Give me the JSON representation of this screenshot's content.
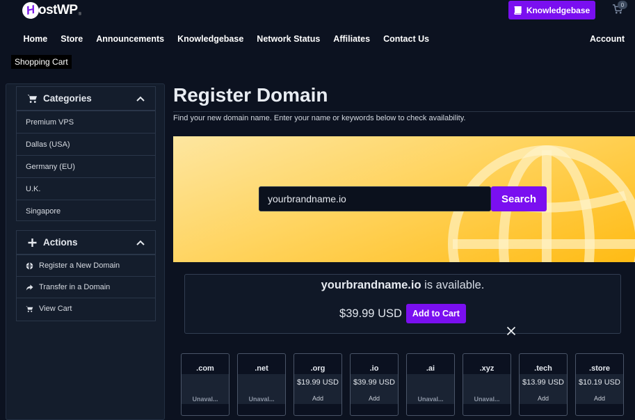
{
  "brand": {
    "logo_letter": "H",
    "logo_text": "ostWP",
    "logo_mark": "®"
  },
  "header": {
    "knowledgebase_button": "Knowledgebase",
    "cart_count": "0"
  },
  "nav": {
    "items": [
      "Home",
      "Store",
      "Announcements",
      "Knowledgebase",
      "Network Status",
      "Affiliates",
      "Contact Us"
    ],
    "account": "Account"
  },
  "breadcrumb": "Shopping Cart",
  "sidebar": {
    "categories": {
      "title": "Categories",
      "icon": "shopping-cart-icon",
      "items": [
        "Premium VPS",
        "Dallas (USA)",
        "Germany (EU)",
        "U.K.",
        "Singapore"
      ]
    },
    "actions": {
      "title": "Actions",
      "icon": "plus-icon",
      "items": [
        {
          "label": "Register a New Domain",
          "icon": "globe-icon"
        },
        {
          "label": "Transfer in a Domain",
          "icon": "share-arrow-icon"
        },
        {
          "label": "View Cart",
          "icon": "shopping-cart-icon"
        }
      ]
    }
  },
  "main": {
    "title": "Register Domain",
    "description": "Find your new domain name. Enter your name or keywords below to check availability.",
    "search": {
      "value": "yourbrandname.io",
      "button": "Search"
    },
    "result": {
      "domain": "yourbrandname.io",
      "status_text": " is available.",
      "price": "$39.99 USD",
      "add_button": "Add to Cart"
    },
    "tlds": [
      {
        "name": ".com",
        "price": "",
        "status": "Unaval..."
      },
      {
        "name": ".net",
        "price": "",
        "status": "Unaval..."
      },
      {
        "name": ".org",
        "price": "$19.99 USD",
        "status": "Add"
      },
      {
        "name": ".io",
        "price": "$39.99 USD",
        "status": "Add"
      },
      {
        "name": ".ai",
        "price": "",
        "status": "Unaval..."
      },
      {
        "name": ".xyz",
        "price": "",
        "status": "Unaval..."
      },
      {
        "name": ".tech",
        "price": "$13.99 USD",
        "status": "Add"
      },
      {
        "name": ".store",
        "price": "$10.19 USD",
        "status": "Add"
      }
    ]
  },
  "colors": {
    "accent": "#7a0ff0",
    "background": "#0c1220",
    "panel": "#141d2c",
    "hero_yellow": "#ffc93a"
  }
}
